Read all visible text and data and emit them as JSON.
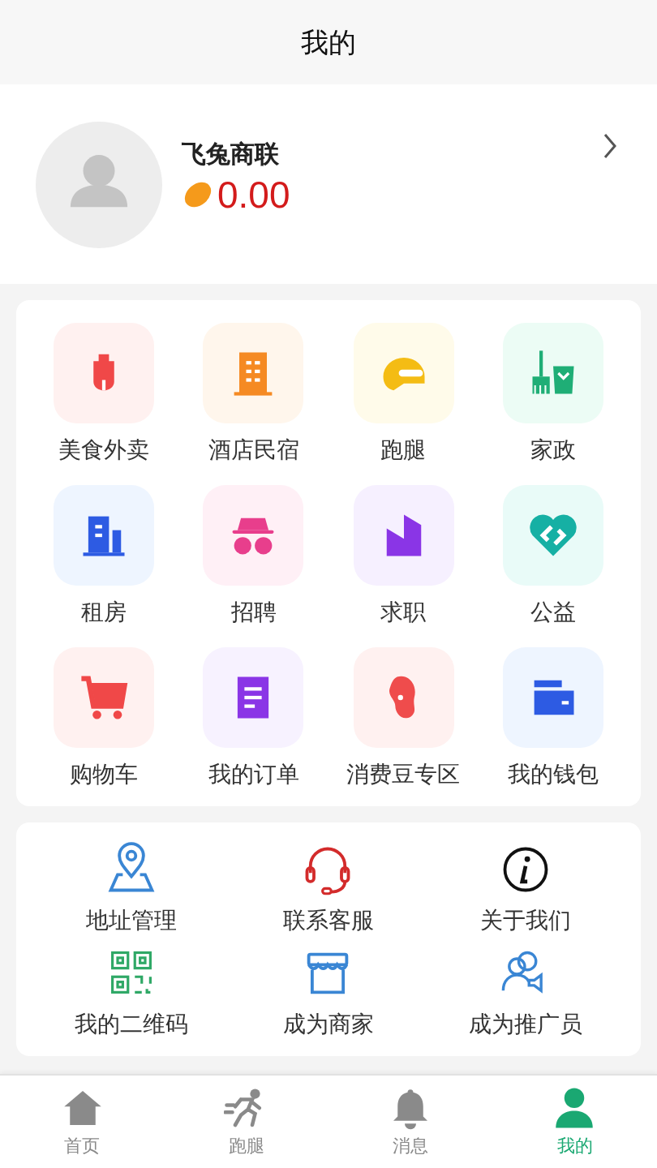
{
  "header": {
    "title": "我的"
  },
  "profile": {
    "name": "飞兔商联",
    "balance": "0.00"
  },
  "services": [
    {
      "label": "美食外卖"
    },
    {
      "label": "酒店民宿"
    },
    {
      "label": "跑腿"
    },
    {
      "label": "家政"
    },
    {
      "label": "租房"
    },
    {
      "label": "招聘"
    },
    {
      "label": "求职"
    },
    {
      "label": "公益"
    },
    {
      "label": "购物车"
    },
    {
      "label": "我的订单"
    },
    {
      "label": "消费豆专区"
    },
    {
      "label": "我的钱包"
    }
  ],
  "tools": [
    {
      "label": "地址管理"
    },
    {
      "label": "联系客服"
    },
    {
      "label": "关于我们"
    },
    {
      "label": "我的二维码"
    },
    {
      "label": "成为商家"
    },
    {
      "label": "成为推广员"
    }
  ],
  "tabs": [
    {
      "label": "首页",
      "selected": false
    },
    {
      "label": "跑腿",
      "selected": false
    },
    {
      "label": "消息",
      "selected": false
    },
    {
      "label": "我的",
      "selected": true
    }
  ]
}
